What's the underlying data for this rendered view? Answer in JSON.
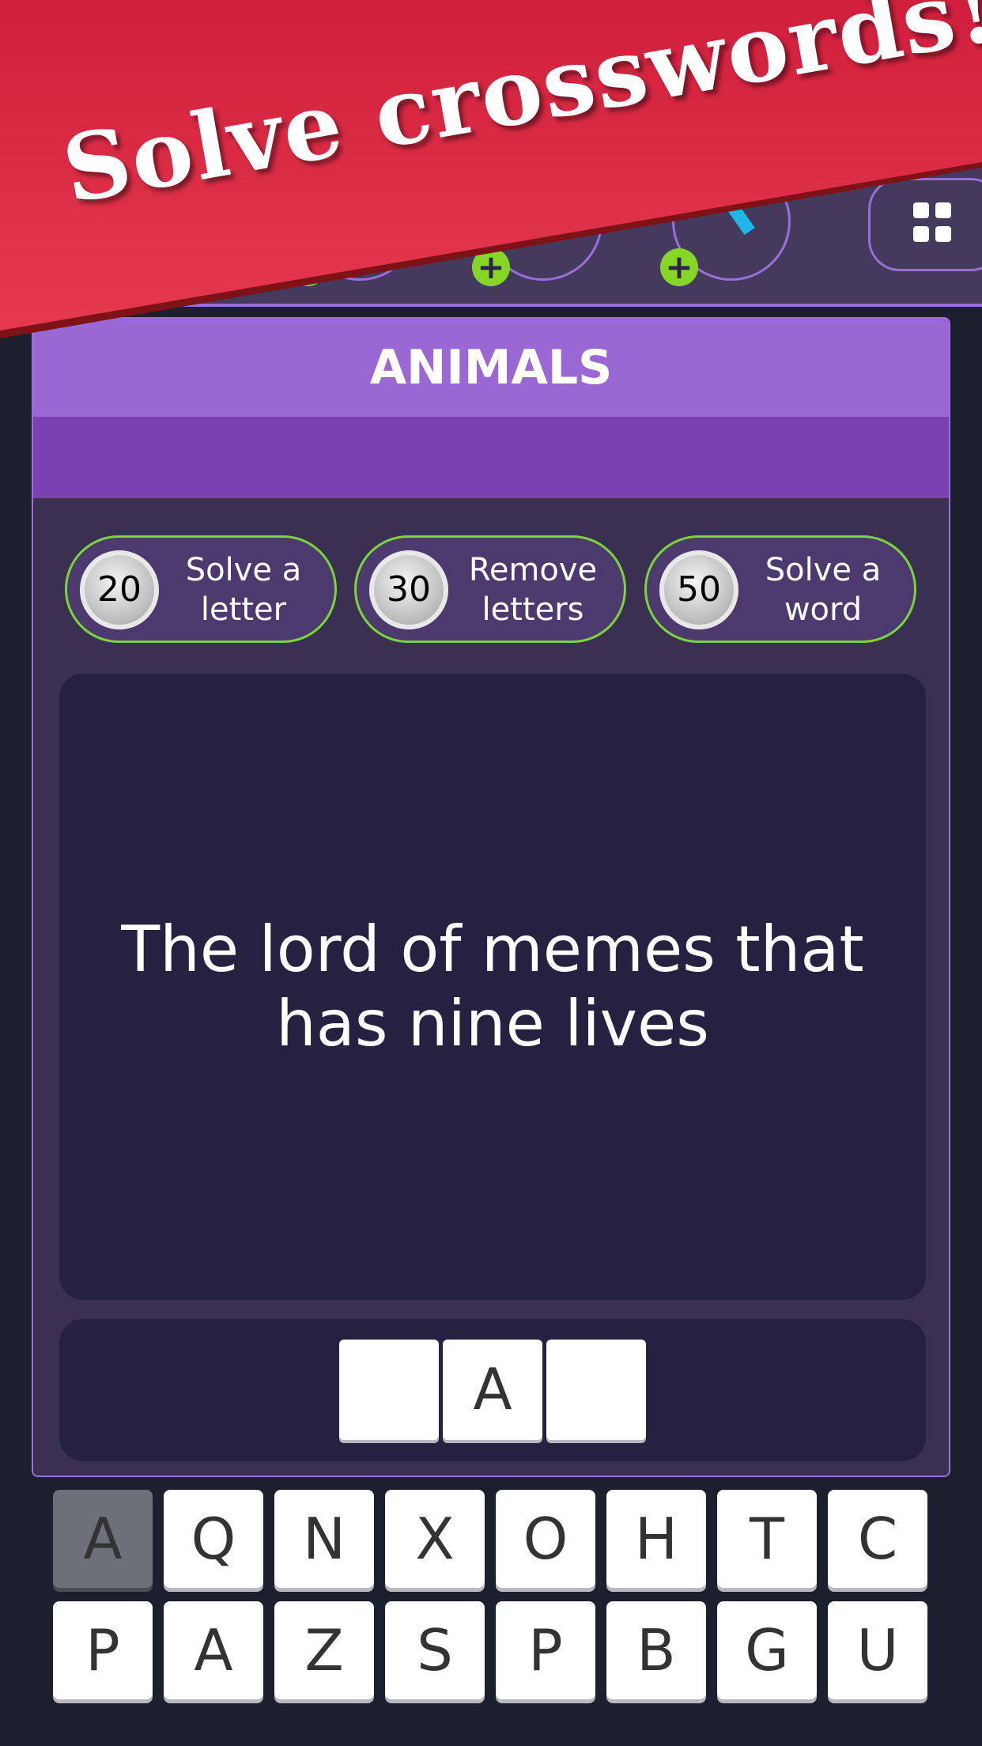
{
  "banner": {
    "text": "Solve crosswords!",
    "color": "#d42a42"
  },
  "topbar": {
    "icons": [
      "coin-icon",
      "hint-icon",
      "key-icon"
    ],
    "menu_icon": "grid-icon",
    "plus": "+"
  },
  "category": {
    "title": "ANIMALS"
  },
  "hints": [
    {
      "cost": "20",
      "label": "Solve a letter"
    },
    {
      "cost": "30",
      "label": "Remove letters"
    },
    {
      "cost": "50",
      "label": "Solve a word"
    }
  ],
  "clue": "The lord of memes that has nine lives",
  "answer": [
    "",
    "A",
    ""
  ],
  "keyboard": {
    "row1": [
      "A",
      "Q",
      "N",
      "X",
      "O",
      "H",
      "T",
      "C"
    ],
    "row2": [
      "P",
      "A",
      "Z",
      "S",
      "P",
      "B",
      "G",
      "U"
    ],
    "used": [
      0
    ]
  }
}
